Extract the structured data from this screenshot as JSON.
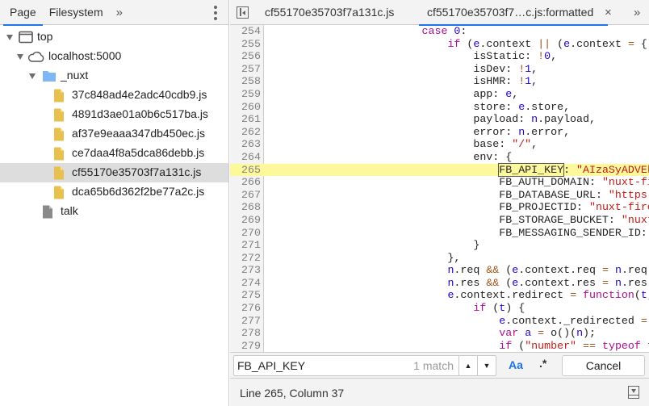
{
  "navigator": {
    "tabs": [
      {
        "label": "Page",
        "active": true
      },
      {
        "label": "Filesystem",
        "active": false
      }
    ],
    "more_label": "»",
    "tree": [
      {
        "label": "top",
        "icon": "frame-icon",
        "depth": 0,
        "expanded": true
      },
      {
        "label": "localhost:5000",
        "icon": "cloud-icon",
        "depth": 1,
        "expanded": true
      },
      {
        "label": "_nuxt",
        "icon": "folder-icon",
        "depth": 2,
        "expanded": true
      },
      {
        "label": "37c848ad4e2adc40cdb9.js",
        "icon": "js-file-icon",
        "depth": 3
      },
      {
        "label": "4891d3ae01a0b6c517ba.js",
        "icon": "js-file-icon",
        "depth": 3
      },
      {
        "label": "af37e9eaaa347db450ec.js",
        "icon": "js-file-icon",
        "depth": 3
      },
      {
        "label": "ce7daa4f8a5dca86debb.js",
        "icon": "js-file-icon",
        "depth": 3
      },
      {
        "label": "cf55170e35703f7a131c.js",
        "icon": "js-file-icon",
        "depth": 3,
        "selected": true
      },
      {
        "label": "dca65b6d362f2be77a2c.js",
        "icon": "js-file-icon",
        "depth": 3
      },
      {
        "label": "talk",
        "icon": "document-icon",
        "depth": 2
      }
    ]
  },
  "editor": {
    "tabs": [
      {
        "label": "cf55170e35703f7a131c.js"
      },
      {
        "label": "cf55170e35703f7…c.js:formatted",
        "active": true
      }
    ],
    "close_label": "×",
    "more_label": "»",
    "highlight_line": 265,
    "lines": [
      {
        "n": 254,
        "t": [
          [
            "p",
            "                        "
          ],
          [
            "k",
            "case"
          ],
          [
            "p",
            " "
          ],
          [
            "n",
            "0"
          ],
          [
            "p",
            ":"
          ]
        ]
      },
      {
        "n": 255,
        "t": [
          [
            "p",
            "                            "
          ],
          [
            "k",
            "if"
          ],
          [
            "p",
            " ("
          ],
          [
            "v",
            "e"
          ],
          [
            "p",
            ".context "
          ],
          [
            "o",
            "||"
          ],
          [
            "p",
            " ("
          ],
          [
            "v",
            "e"
          ],
          [
            "p",
            ".context "
          ],
          [
            "o",
            "="
          ],
          [
            "p",
            " {"
          ]
        ]
      },
      {
        "n": 256,
        "t": [
          [
            "p",
            "                                isStatic: "
          ],
          [
            "o",
            "!"
          ],
          [
            "n",
            "0"
          ],
          [
            "p",
            ","
          ]
        ]
      },
      {
        "n": 257,
        "t": [
          [
            "p",
            "                                isDev: "
          ],
          [
            "o",
            "!"
          ],
          [
            "n",
            "1"
          ],
          [
            "p",
            ","
          ]
        ]
      },
      {
        "n": 258,
        "t": [
          [
            "p",
            "                                isHMR: "
          ],
          [
            "o",
            "!"
          ],
          [
            "n",
            "1"
          ],
          [
            "p",
            ","
          ]
        ]
      },
      {
        "n": 259,
        "t": [
          [
            "p",
            "                                app: "
          ],
          [
            "v",
            "e"
          ],
          [
            "p",
            ","
          ]
        ]
      },
      {
        "n": 260,
        "t": [
          [
            "p",
            "                                store: "
          ],
          [
            "v",
            "e"
          ],
          [
            "p",
            ".store,"
          ]
        ]
      },
      {
        "n": 261,
        "t": [
          [
            "p",
            "                                payload: "
          ],
          [
            "v",
            "n"
          ],
          [
            "p",
            ".payload,"
          ]
        ]
      },
      {
        "n": 262,
        "t": [
          [
            "p",
            "                                error: "
          ],
          [
            "v",
            "n"
          ],
          [
            "p",
            ".error,"
          ]
        ]
      },
      {
        "n": 263,
        "t": [
          [
            "p",
            "                                base: "
          ],
          [
            "s",
            "\"/\""
          ],
          [
            "p",
            ","
          ]
        ]
      },
      {
        "n": 264,
        "t": [
          [
            "p",
            "                                env: {"
          ]
        ]
      },
      {
        "n": 265,
        "t": [
          [
            "p",
            "                                    "
          ],
          [
            "m",
            "FB_API_KEY"
          ],
          [
            "p",
            ": "
          ],
          [
            "s",
            "\"AIzaSyADVEk"
          ]
        ]
      },
      {
        "n": 266,
        "t": [
          [
            "p",
            "                                    FB_AUTH_DOMAIN: "
          ],
          [
            "s",
            "\"nuxt-fi"
          ]
        ]
      },
      {
        "n": 267,
        "t": [
          [
            "p",
            "                                    FB_DATABASE_URL: "
          ],
          [
            "s",
            "\"https"
          ]
        ]
      },
      {
        "n": 268,
        "t": [
          [
            "p",
            "                                    FB_PROJECTID: "
          ],
          [
            "s",
            "\"nuxt-fire"
          ]
        ]
      },
      {
        "n": 269,
        "t": [
          [
            "p",
            "                                    FB_STORAGE_BUCKET: "
          ],
          [
            "s",
            "\"nuxt"
          ]
        ]
      },
      {
        "n": 270,
        "t": [
          [
            "p",
            "                                    FB_MESSAGING_SENDER_ID:"
          ]
        ]
      },
      {
        "n": 271,
        "t": [
          [
            "p",
            "                                }"
          ]
        ]
      },
      {
        "n": 272,
        "t": [
          [
            "p",
            "                            },"
          ]
        ]
      },
      {
        "n": 273,
        "t": [
          [
            "p",
            "                            "
          ],
          [
            "v",
            "n"
          ],
          [
            "p",
            ".req "
          ],
          [
            "o",
            "&&"
          ],
          [
            "p",
            " ("
          ],
          [
            "v",
            "e"
          ],
          [
            "p",
            ".context.req "
          ],
          [
            "o",
            "="
          ],
          [
            "p",
            " "
          ],
          [
            "v",
            "n"
          ],
          [
            "p",
            ".req)"
          ]
        ]
      },
      {
        "n": 274,
        "t": [
          [
            "p",
            "                            "
          ],
          [
            "v",
            "n"
          ],
          [
            "p",
            ".res "
          ],
          [
            "o",
            "&&"
          ],
          [
            "p",
            " ("
          ],
          [
            "v",
            "e"
          ],
          [
            "p",
            ".context.res "
          ],
          [
            "o",
            "="
          ],
          [
            "p",
            " "
          ],
          [
            "v",
            "n"
          ],
          [
            "p",
            ".res)"
          ]
        ]
      },
      {
        "n": 275,
        "t": [
          [
            "p",
            "                            "
          ],
          [
            "v",
            "e"
          ],
          [
            "p",
            ".context.redirect "
          ],
          [
            "o",
            "="
          ],
          [
            "p",
            " "
          ],
          [
            "k",
            "function"
          ],
          [
            "p",
            "("
          ],
          [
            "v",
            "t"
          ],
          [
            "p",
            ","
          ]
        ]
      },
      {
        "n": 276,
        "t": [
          [
            "p",
            "                                "
          ],
          [
            "k",
            "if"
          ],
          [
            "p",
            " ("
          ],
          [
            "v",
            "t"
          ],
          [
            "p",
            ") {"
          ]
        ]
      },
      {
        "n": 277,
        "t": [
          [
            "p",
            "                                    "
          ],
          [
            "v",
            "e"
          ],
          [
            "p",
            ".context._redirected "
          ],
          [
            "o",
            "="
          ]
        ]
      },
      {
        "n": 278,
        "t": [
          [
            "p",
            "                                    "
          ],
          [
            "k",
            "var"
          ],
          [
            "p",
            " "
          ],
          [
            "v",
            "a"
          ],
          [
            "p",
            " "
          ],
          [
            "o",
            "="
          ],
          [
            "p",
            " o()("
          ],
          [
            "v",
            "n"
          ],
          [
            "p",
            ");"
          ]
        ]
      },
      {
        "n": 279,
        "t": [
          [
            "p",
            "                                    "
          ],
          [
            "k",
            "if"
          ],
          [
            "p",
            " ("
          ],
          [
            "s",
            "\"number\""
          ],
          [
            "p",
            " "
          ],
          [
            "o",
            "=="
          ],
          [
            "p",
            " "
          ],
          [
            "k",
            "typeof"
          ],
          [
            "p",
            " t"
          ]
        ]
      }
    ]
  },
  "search": {
    "query": "FB_API_KEY",
    "match_count": "1 match",
    "prev_label": "▲",
    "next_label": "▼",
    "case_label": "Aa",
    "regex_label": ".*",
    "cancel_label": "Cancel"
  },
  "status": {
    "position": "Line 265, Column 37"
  },
  "colors": {
    "accent": "#1a73e8",
    "highlight": "#fdf99b",
    "keyword": "#aa0d91",
    "string": "#c41a16",
    "number": "#1c00cf",
    "file_icon": "#e8c04f",
    "folder_icon": "#7fb6f5"
  }
}
